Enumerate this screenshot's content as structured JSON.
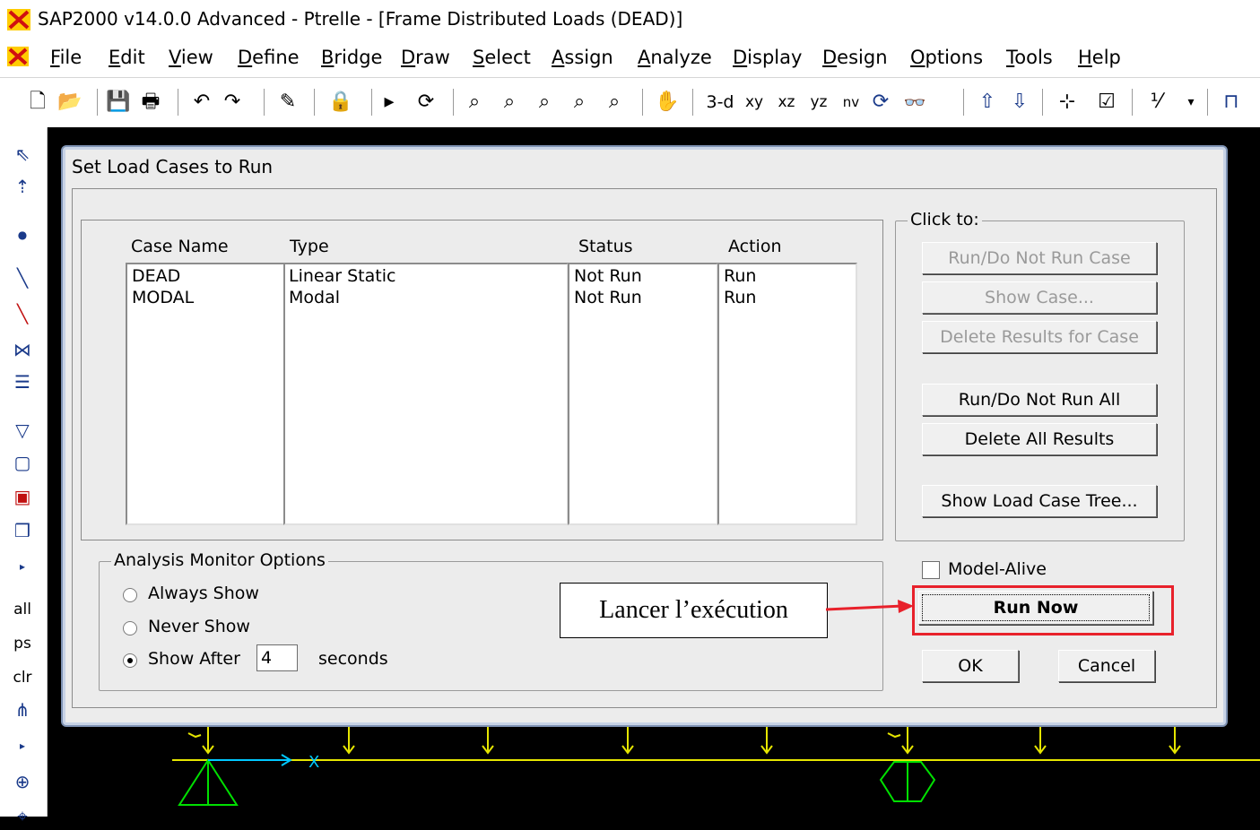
{
  "window": {
    "title": "SAP2000 v14.0.0 Advanced  - Ptrelle - [Frame Distributed Loads (DEAD)]"
  },
  "menu": [
    "File",
    "Edit",
    "View",
    "Define",
    "Bridge",
    "Draw",
    "Select",
    "Assign",
    "Analyze",
    "Display",
    "Design",
    "Options",
    "Tools",
    "Help"
  ],
  "toolbar": {
    "view_3d": "3-d",
    "view_xy": "xy",
    "view_xz": "xz",
    "view_yz": "yz",
    "view_nv": "nv"
  },
  "lefttoolbar": {
    "all": "all",
    "ps": "ps",
    "clr": "clr"
  },
  "dialog": {
    "title": "Set Load Cases to Run",
    "columns": {
      "case_name": "Case Name",
      "type": "Type",
      "status": "Status",
      "action": "Action"
    },
    "cases": [
      {
        "name": "DEAD",
        "type": "Linear Static",
        "status": "Not Run",
        "action": "Run"
      },
      {
        "name": "MODAL",
        "type": "Modal",
        "status": "Not Run",
        "action": "Run"
      }
    ],
    "click_to": {
      "label": "Click to:",
      "run_do_not_run_case": "Run/Do Not Run Case",
      "show_case": "Show Case...",
      "delete_results_for_case": "Delete Results for Case",
      "run_do_not_run_all": "Run/Do Not Run All",
      "delete_all_results": "Delete All Results",
      "show_load_case_tree": "Show Load Case Tree..."
    },
    "model_alive": {
      "label": "Model-Alive",
      "checked": false
    },
    "run_now": "Run Now",
    "ok": "OK",
    "cancel": "Cancel",
    "monitor": {
      "label": "Analysis Monitor Options",
      "always_show": "Always Show",
      "never_show": "Never Show",
      "show_after": "Show After",
      "seconds_value": "4",
      "seconds_label": "seconds",
      "selected": "show_after"
    }
  },
  "annotation": {
    "text": "Lancer l’exécution"
  },
  "colors": {
    "highlight": "#e8212b",
    "model_lines": "#e6e600",
    "supports": "#00e000",
    "axis": "#00c8ff"
  }
}
